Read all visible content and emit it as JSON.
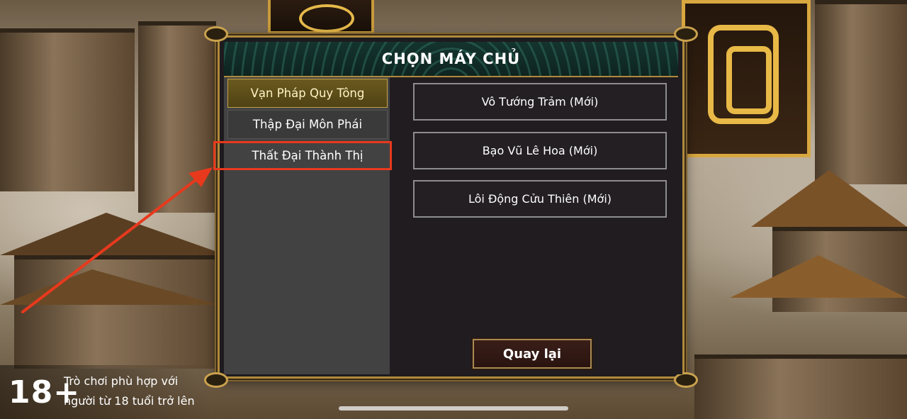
{
  "dialog": {
    "title": "CHỌN MÁY CHỦ"
  },
  "categories": [
    {
      "label": "Vạn Pháp Quy Tông",
      "state": "selected"
    },
    {
      "label": "Thập Đại Môn Phái",
      "state": "normal"
    },
    {
      "label": "Thất Đại Thành Thị",
      "state": "highlighted"
    }
  ],
  "servers": [
    {
      "label": "Vô Tướng Trảm (Mới)"
    },
    {
      "label": "Bạo Vũ Lê Hoa (Mới)"
    },
    {
      "label": "Lôi Động Cửu Thiên (Mới)"
    }
  ],
  "back_button": {
    "label": "Quay lại"
  },
  "age_notice": {
    "rating": "18+",
    "line1": "Trò chơi phù hợp với",
    "line2": "người từ 18 tuổi trở lên"
  },
  "colors": {
    "accent_gold": "#b08a3c",
    "annotation_red": "#e8391d",
    "header_teal": "#14342e"
  }
}
